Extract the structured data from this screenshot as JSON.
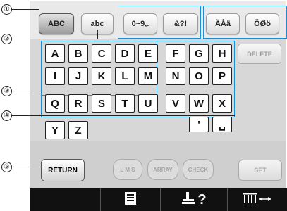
{
  "callouts": [
    "①",
    "②",
    "③",
    "④",
    "⑤"
  ],
  "mode_buttons": [
    {
      "label": "ABC",
      "active": true
    },
    {
      "label": "abc",
      "active": false
    },
    {
      "label": "0~9,.",
      "active": false
    },
    {
      "label": "&?!",
      "active": false
    },
    {
      "label": "ÄÅä",
      "active": false
    },
    {
      "label": "ÖØö",
      "active": false
    }
  ],
  "keys": {
    "row1": [
      "A",
      "B",
      "C",
      "D",
      "E",
      "F",
      "G",
      "H"
    ],
    "row2": [
      "I",
      "J",
      "K",
      "L",
      "M",
      "N",
      "O",
      "P"
    ],
    "row3": [
      "Q",
      "R",
      "S",
      "T",
      "U",
      "V",
      "W",
      "X"
    ],
    "row4": [
      "Y",
      "Z"
    ],
    "apostrophe": "'",
    "space": "␣"
  },
  "delete_label": "DELETE",
  "return_label": "RETURN",
  "set_label": "SET",
  "tool_buttons": [
    {
      "label": "L M S"
    },
    {
      "label": "ARRAY"
    },
    {
      "label": "CHECK"
    }
  ],
  "nav": {
    "help_label": "?",
    "icons": [
      "list-icon",
      "sewing-machine-help-icon",
      "spacing-icon"
    ]
  },
  "colors": {
    "highlight": "#1a8fd8"
  }
}
